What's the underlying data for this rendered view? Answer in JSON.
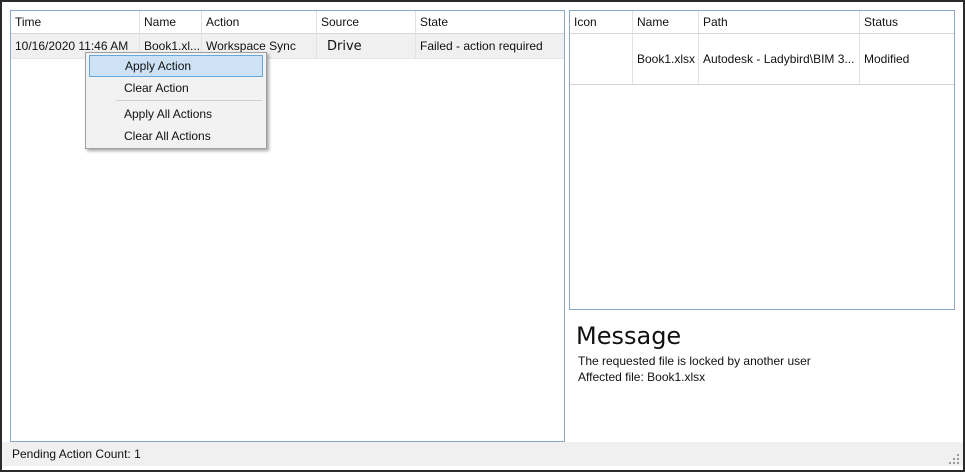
{
  "left_grid": {
    "columns": [
      "Time",
      "Name",
      "Action",
      "Source",
      "State"
    ],
    "rows": [
      {
        "time": "10/16/2020 11:46 AM",
        "name": "Book1.xl...",
        "action": "Workspace Sync",
        "source": "Drive",
        "state": "Failed - action required"
      }
    ]
  },
  "context_menu": {
    "items": [
      "Apply Action",
      "Clear Action",
      "Apply All Actions",
      "Clear All Actions"
    ],
    "highlighted": "Apply Action"
  },
  "right_grid": {
    "columns": [
      "Icon",
      "Name",
      "Path",
      "Status"
    ],
    "rows": [
      {
        "icon": "",
        "name": "Book1.xlsx",
        "path": "Autodesk - Ladybird\\BIM 3...",
        "status": "Modified"
      }
    ]
  },
  "message": {
    "title": "Message",
    "lines": [
      "The requested file is locked by another user",
      "Affected file: Book1.xlsx"
    ]
  },
  "status_bar": {
    "text": "Pending Action Count: 1"
  },
  "colors": {
    "panel_border": "#8aa9c7",
    "menu_highlight": "#cde3f5",
    "menu_highlight_border": "#66a7dd"
  }
}
